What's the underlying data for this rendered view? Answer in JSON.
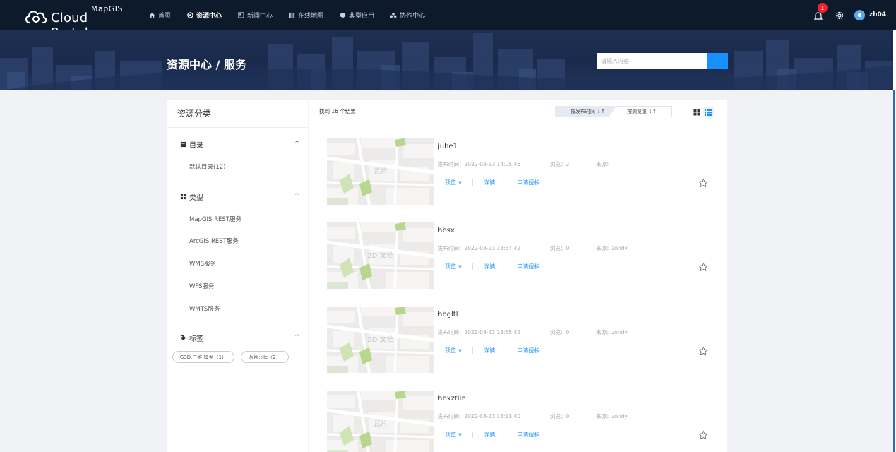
{
  "brand": {
    "top": "MapGIS",
    "main": "Cloud Portal"
  },
  "nav": {
    "items": [
      {
        "label": "首页",
        "icon": "home-icon"
      },
      {
        "label": "资源中心",
        "icon": "resource-icon"
      },
      {
        "label": "新闻中心",
        "icon": "news-icon"
      },
      {
        "label": "在线地图",
        "icon": "map-icon"
      },
      {
        "label": "典型应用",
        "icon": "app-icon"
      },
      {
        "label": "协作中心",
        "icon": "team-icon"
      }
    ],
    "active_index": 1,
    "notifications": "1",
    "username": "zh04"
  },
  "banner": {
    "title": "资源中心 / 服务"
  },
  "search": {
    "placeholder": "请输入内容"
  },
  "sidebar": {
    "title": "资源分类",
    "catalog": {
      "label": "目录",
      "items": [
        "默认目录(12)"
      ]
    },
    "types": {
      "label": "类型",
      "items": [
        "MapGIS REST服务",
        "ArcGIS REST服务",
        "WMS服务",
        "WFS服务",
        "WMTS服务"
      ]
    },
    "tags": {
      "label": "标签",
      "items": [
        "G3D,三维,模型（1）",
        "瓦片,tile（2）"
      ]
    }
  },
  "results": {
    "count_text": "找到 16 个结果",
    "sort_publish": "按发布时间 ↓↑",
    "sort_views": "按浏览量 ↓↑",
    "items": [
      {
        "title": "juhe1",
        "thumb": "瓦片",
        "published": "发布时间：2022-03-23 14:05:46",
        "views": "浏览：2",
        "source": "来源："
      },
      {
        "title": "hbsx",
        "thumb": "2D 文档",
        "published": "发布时间：2022-03-23 13:57:42",
        "views": "浏览：0",
        "source": "来源：zondy"
      },
      {
        "title": "hbgltl",
        "thumb": "2D 文档",
        "published": "发布时间：2022-03-23 13:55:42",
        "views": "浏览：0",
        "source": "来源：zondy"
      },
      {
        "title": "hbxztile",
        "thumb": "瓦片",
        "published": "发布时间：2022-03-23 13:13:40",
        "views": "浏览：0",
        "source": "来源：zondy"
      }
    ],
    "actions": {
      "preview": "预览 ∨",
      "detail": "详情",
      "apply": "申请授权"
    }
  },
  "colors": {
    "nav_bg": "#0d1a2c",
    "accent": "#1890ff",
    "badge": "#f5222d"
  }
}
